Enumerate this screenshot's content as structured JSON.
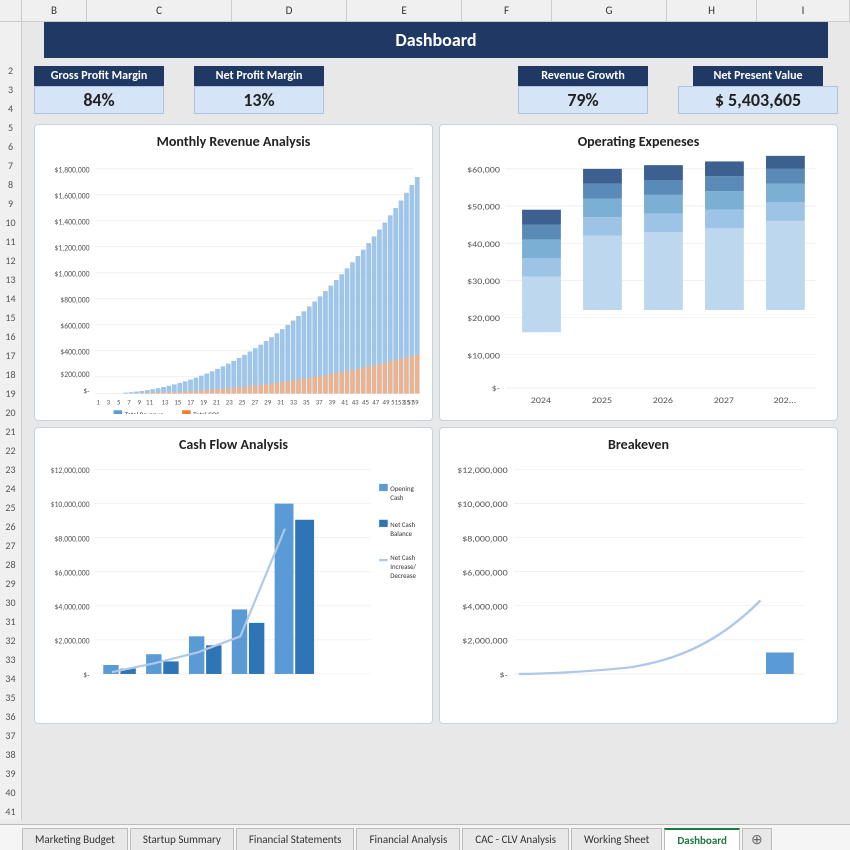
{
  "header": {
    "title": "Dashboard",
    "columns": [
      "B",
      "C",
      "D",
      "E",
      "F",
      "G",
      "H",
      "I"
    ]
  },
  "kpis": [
    {
      "label": "Gross Profit Margin",
      "value": "84%",
      "prefix": ""
    },
    {
      "label": "Net Profit Margin",
      "value": "13%",
      "prefix": ""
    },
    {
      "label": "Revenue Growth",
      "value": "79%",
      "prefix": ""
    },
    {
      "label": "Net Present Value",
      "value": "5,403,605",
      "prefix": "$"
    }
  ],
  "charts": {
    "monthly_revenue": {
      "title": "Monthly Revenue Analysis",
      "y_labels": [
        "$1,800,000",
        "$1,600,000",
        "$1,400,000",
        "$1,200,000",
        "$1,000,000",
        "$800,000",
        "$600,000",
        "$400,000",
        "$200,000",
        "$-"
      ],
      "x_labels": [
        "1",
        "3",
        "5",
        "7",
        "9",
        "11",
        "13",
        "15",
        "17",
        "19",
        "21",
        "23",
        "25",
        "27",
        "29",
        "31",
        "33",
        "35",
        "37",
        "39",
        "41",
        "43",
        "45",
        "47",
        "49",
        "51",
        "53",
        "55",
        "57",
        "59"
      ],
      "legend": [
        "Total Revenue",
        "Total COS"
      ]
    },
    "operating_expenses": {
      "title": "Operating Expeneses",
      "y_labels": [
        "$60,000",
        "$50,000",
        "$40,000",
        "$30,000",
        "$20,000",
        "$10,000",
        "$-"
      ],
      "x_labels": [
        "2024",
        "2025",
        "2026",
        "2027",
        "202..."
      ]
    },
    "cash_flow": {
      "title": "Cash Flow Analysis",
      "y_labels": [
        "$12,000,000",
        "$10,000,000",
        "$8,000,000",
        "$6,000,000",
        "$4,000,000",
        "$2,000,000",
        "$-"
      ],
      "legend": [
        "Opening Cash",
        "Net Cash Balance",
        "Net Cash Increase/Decrease"
      ]
    },
    "breakeven": {
      "title": "Breakeven",
      "y_labels": [
        "$12,000,000",
        "$10,000,000",
        "$8,000,000",
        "$6,000,000",
        "$4,000,000",
        "$2,000,000",
        "$-"
      ]
    }
  },
  "tabs": [
    {
      "label": "Marketing Budget",
      "active": false
    },
    {
      "label": "Startup Summary",
      "active": false
    },
    {
      "label": "Financial Statements",
      "active": false
    },
    {
      "label": "Financial Analysis",
      "active": false
    },
    {
      "label": "CAC - CLV Analysis",
      "active": false
    },
    {
      "label": "Working Sheet",
      "active": false
    },
    {
      "label": "Dashboard",
      "active": true
    }
  ]
}
